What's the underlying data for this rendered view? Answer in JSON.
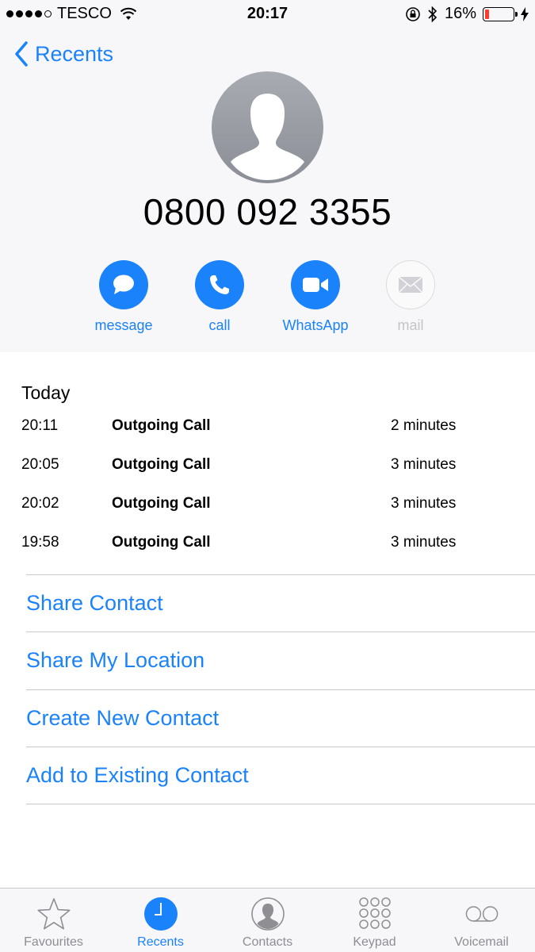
{
  "status_bar": {
    "carrier": "TESCO",
    "time": "20:17",
    "battery_percent": "16%",
    "battery_level": 0.16,
    "battery_color": "#ff3b30"
  },
  "nav": {
    "back_label": "Recents"
  },
  "contact": {
    "number": "0800 092 3355"
  },
  "actions": [
    {
      "label": "message",
      "icon": "message-bubble-icon",
      "enabled": true
    },
    {
      "label": "call",
      "icon": "phone-icon",
      "enabled": true
    },
    {
      "label": "WhatsApp",
      "icon": "video-camera-icon",
      "enabled": true
    },
    {
      "label": "mail",
      "icon": "envelope-icon",
      "enabled": false
    }
  ],
  "calls": {
    "day": "Today",
    "rows": [
      {
        "time": "20:11",
        "type": "Outgoing Call",
        "duration": "2 minutes"
      },
      {
        "time": "20:05",
        "type": "Outgoing Call",
        "duration": "3 minutes"
      },
      {
        "time": "20:02",
        "type": "Outgoing Call",
        "duration": "3 minutes"
      },
      {
        "time": "19:58",
        "type": "Outgoing Call",
        "duration": "3 minutes"
      }
    ]
  },
  "options": [
    "Share Contact",
    "Share My Location",
    "Create New Contact",
    "Add to Existing Contact"
  ],
  "tabs": [
    {
      "label": "Favourites",
      "icon": "star-icon",
      "active": false
    },
    {
      "label": "Recents",
      "icon": "clock-icon",
      "active": true
    },
    {
      "label": "Contacts",
      "icon": "person-icon",
      "active": false
    },
    {
      "label": "Keypad",
      "icon": "keypad-icon",
      "active": false
    },
    {
      "label": "Voicemail",
      "icon": "voicemail-icon",
      "active": false
    }
  ],
  "colors": {
    "accent": "#1a82fb",
    "inactive": "#8e8e93",
    "disabled": "#c4c4c8"
  }
}
